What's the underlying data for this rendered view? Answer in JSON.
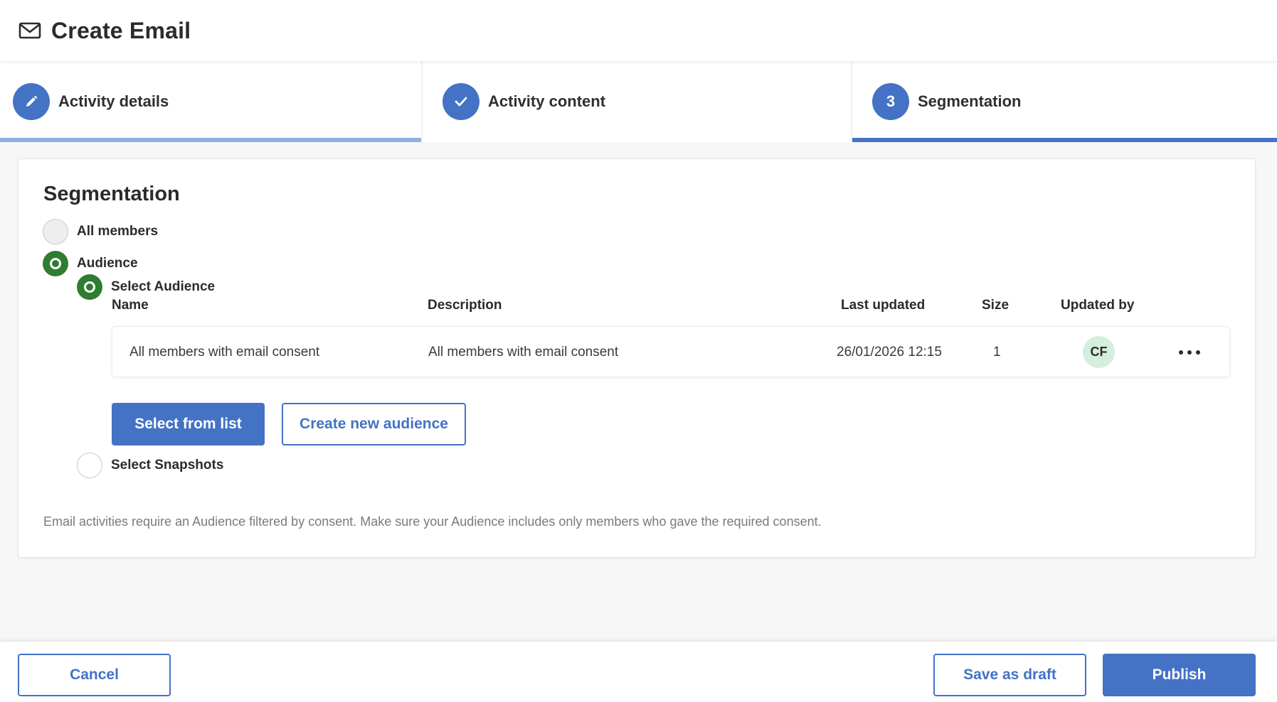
{
  "header": {
    "title": "Create Email",
    "icon": "mail-icon"
  },
  "stepper": {
    "steps": [
      {
        "label": "Activity details",
        "icon": "pencil-icon",
        "state": "edit"
      },
      {
        "label": "Activity content",
        "icon": "check-icon",
        "state": "completed"
      },
      {
        "label": "Segmentation",
        "number": "3",
        "state": "active"
      }
    ]
  },
  "segmentation": {
    "title": "Segmentation",
    "options": {
      "all_members": "All members",
      "audience": "Audience",
      "select_audience": "Select Audience",
      "select_snapshots": "Select Snapshots"
    },
    "selected": "audience",
    "sub_selected": "select_audience",
    "table": {
      "headers": {
        "name": "Name",
        "description": "Description",
        "last_updated": "Last updated",
        "size": "Size",
        "updated_by": "Updated by"
      },
      "rows": [
        {
          "name": "All members with email consent",
          "description": "All members with email consent",
          "last_updated": "26/01/2026 12:15",
          "size": "1",
          "updated_by": "CF"
        }
      ]
    },
    "buttons": {
      "select_from_list": "Select from list",
      "create_new_audience": "Create new audience"
    },
    "note": "Email activities require an Audience filtered by consent. Make sure your Audience includes only members who gave the required consent."
  },
  "footer": {
    "cancel": "Cancel",
    "save_draft": "Save as draft",
    "publish": "Publish"
  },
  "colors": {
    "primary": "#4472c4",
    "radio_selected": "#2e7d32",
    "avatar_bg": "#d4efdc"
  }
}
